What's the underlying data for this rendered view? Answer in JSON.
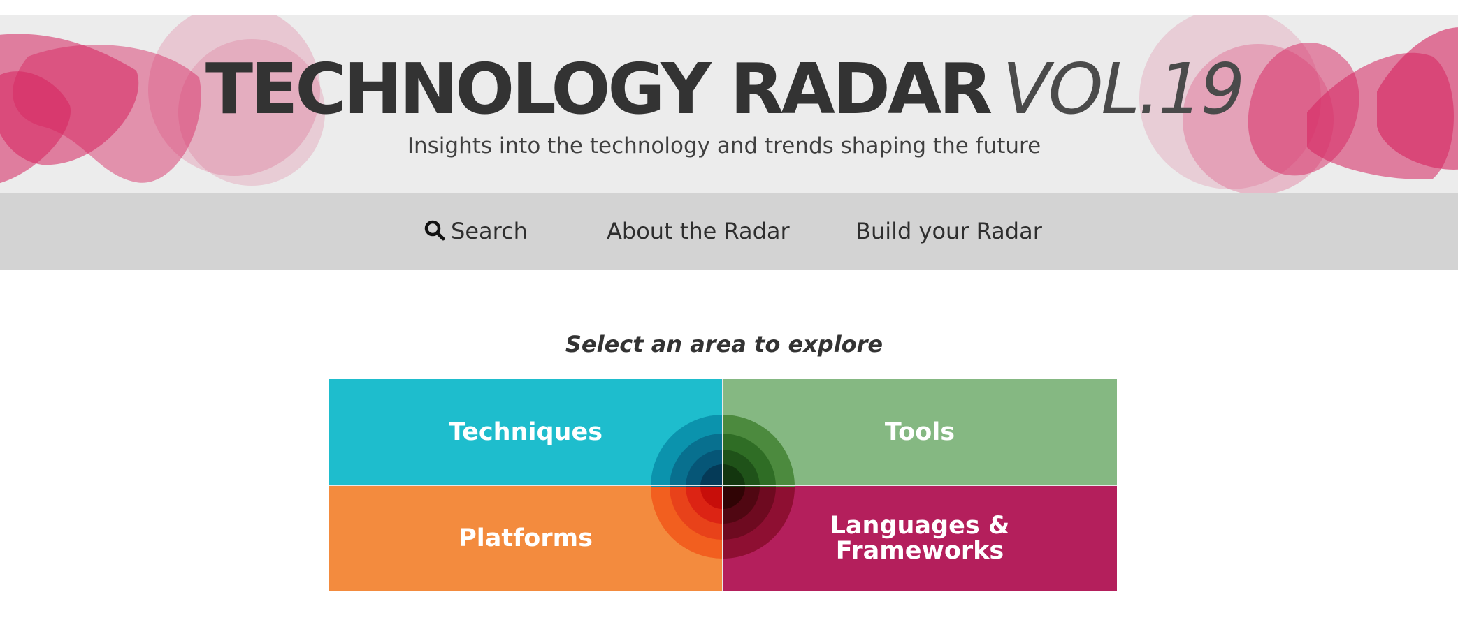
{
  "header": {
    "title_bold": "TECHNOLOGY RADAR",
    "title_light": "VOL.19",
    "subtitle": "Insights into the technology and trends shaping the future",
    "accent_color": "#d6235f"
  },
  "nav": {
    "search_label": "Search",
    "search_icon": "search-icon",
    "about_label": "About the Radar",
    "build_label": "Build your Radar"
  },
  "main": {
    "prompt": "Select an area to explore",
    "quadrants": [
      {
        "label": "Techniques",
        "color": "#1ebdcd"
      },
      {
        "label": "Tools",
        "color": "#85b882"
      },
      {
        "label": "Platforms",
        "color": "#f38b3e"
      },
      {
        "label_line1": "Languages &",
        "label_line2": "Frameworks",
        "color": "#b41f5c"
      }
    ]
  }
}
